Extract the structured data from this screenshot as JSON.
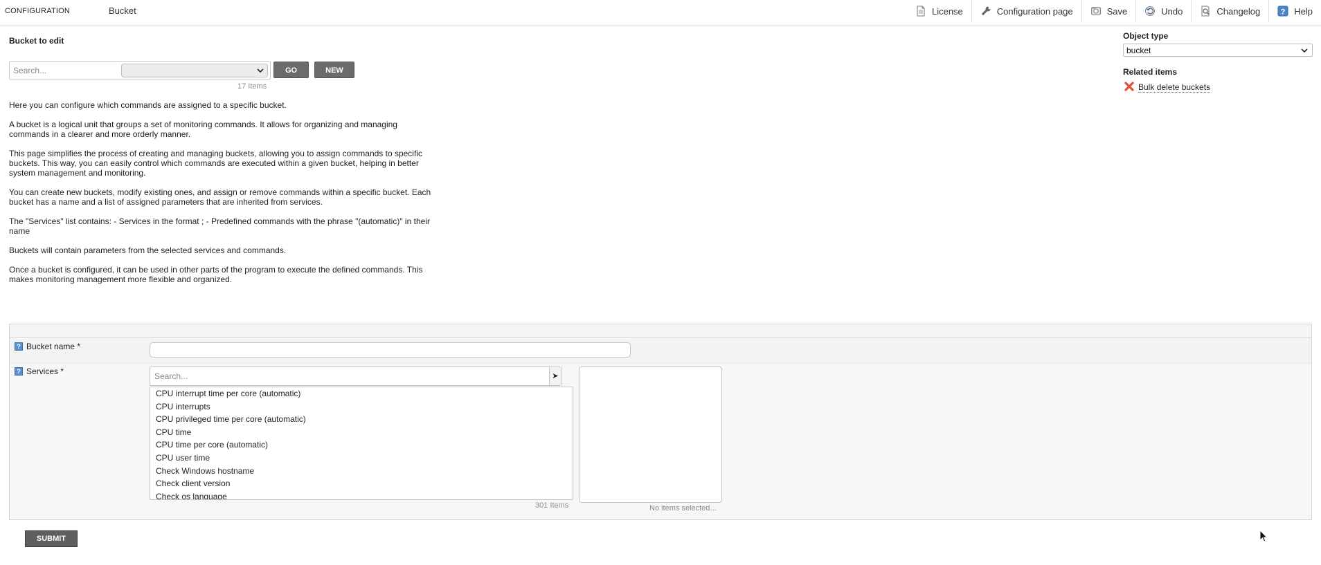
{
  "header": {
    "section": "CONFIGURATION",
    "title": "Bucket",
    "nav": [
      {
        "label": "License",
        "icon": "document-icon"
      },
      {
        "label": "Configuration page",
        "icon": "wrench-icon"
      },
      {
        "label": "Save",
        "icon": "save-icon"
      },
      {
        "label": "Undo",
        "icon": "undo-icon"
      },
      {
        "label": "Changelog",
        "icon": "changelog-icon"
      },
      {
        "label": "Help",
        "icon": "help-icon"
      }
    ]
  },
  "picker": {
    "title": "Bucket to edit",
    "search_placeholder": "Search...",
    "select_value": "",
    "go_label": "GO",
    "new_label": "NEW",
    "items_count": "17 Items"
  },
  "description": [
    "Here you can configure which commands are assigned to a specific bucket.",
    "A bucket is a logical unit that groups a set of monitoring commands. It allows for organizing and managing commands in a clearer and more orderly manner.",
    "This page simplifies the process of creating and managing buckets, allowing you to assign commands to specific buckets. This way, you can easily control which commands are executed within a given bucket, helping in better system management and monitoring.",
    "You can create new buckets, modify existing ones, and assign or remove commands within a specific bucket. Each bucket has a name and a list of assigned parameters that are inherited from services.",
    "The \"Services\" list contains: - Services in the format ; - Predefined commands with the phrase \"(automatic)\" in their name",
    "Buckets will contain parameters from the selected services and commands.",
    "Once a bucket is configured, it can be used in other parts of the program to execute the defined commands. This makes monitoring management more flexible and organized."
  ],
  "sidebar": {
    "object_type_label": "Object type",
    "object_type_value": "bucket",
    "related_label": "Related items",
    "related_items": [
      {
        "label": "Bulk delete buckets",
        "icon": "delete-x-icon"
      }
    ]
  },
  "form": {
    "bucket_name_label": "Bucket name *",
    "bucket_name_value": "",
    "services_label": "Services *",
    "services_search_placeholder": "Search...",
    "services_options": [
      "CPU interrupt time per core (automatic)",
      "CPU interrupts",
      "CPU privileged time per core (automatic)",
      "CPU time",
      "CPU time per core (automatic)",
      "CPU user time",
      "Check Windows hostname",
      "Check client version",
      "Check os language"
    ],
    "services_count": "301 Items",
    "selected_empty": "No items selected...",
    "submit_label": "SUBMIT"
  },
  "colors": {
    "button_dark": "#6b6b6b",
    "help_icon": "#5b8fd0",
    "delete_icon": "#e0533a"
  }
}
